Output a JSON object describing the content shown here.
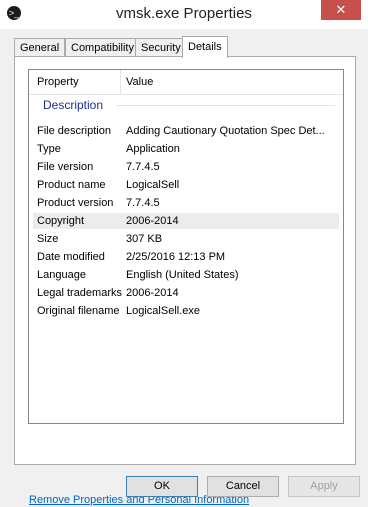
{
  "window": {
    "title": "vmsk.exe Properties",
    "close_glyph": "✕"
  },
  "tabs": [
    {
      "label": "General"
    },
    {
      "label": "Compatibility"
    },
    {
      "label": "Security"
    },
    {
      "label": "Details",
      "active": true
    }
  ],
  "details": {
    "header": {
      "property": "Property",
      "value": "Value"
    },
    "group_label": "Description",
    "rows": [
      {
        "property": "File description",
        "value": "Adding Cautionary Quotation Spec Det..."
      },
      {
        "property": "Type",
        "value": "Application"
      },
      {
        "property": "File version",
        "value": "7.7.4.5"
      },
      {
        "property": "Product name",
        "value": "LogicalSell"
      },
      {
        "property": "Product version",
        "value": "7.7.4.5"
      },
      {
        "property": "Copyright",
        "value": "2006-2014",
        "selected": true
      },
      {
        "property": "Size",
        "value": "307 KB"
      },
      {
        "property": "Date modified",
        "value": "2/25/2016 12:13 PM"
      },
      {
        "property": "Language",
        "value": "English (United States)"
      },
      {
        "property": "Legal trademarks",
        "value": "2006-2014"
      },
      {
        "property": "Original filename",
        "value": "LogicalSell.exe"
      }
    ]
  },
  "remove_link": "Remove Properties and Personal Information",
  "buttons": {
    "ok": "OK",
    "cancel": "Cancel",
    "apply": "Apply"
  },
  "colors": {
    "accent": "#1e3287",
    "link": "#0066cc",
    "close": "#c7504c"
  }
}
